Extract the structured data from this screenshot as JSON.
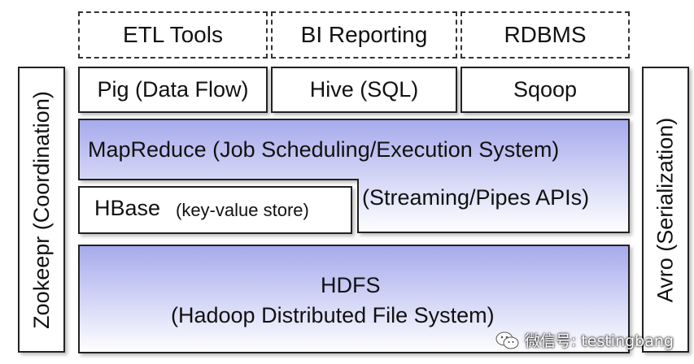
{
  "top_row": {
    "etl": "ETL Tools",
    "bi": "BI Reporting",
    "rdbms": "RDBMS"
  },
  "tools_row": {
    "pig": "Pig (Data Flow)",
    "hive": "Hive (SQL)",
    "sqoop": "Sqoop"
  },
  "mapreduce": {
    "title": "MapReduce (Job Scheduling/Execution System)",
    "streaming": "(Streaming/Pipes APIs)"
  },
  "hbase": {
    "name": "HBase",
    "note": "(key-value store)"
  },
  "hdfs": {
    "title": "HDFS",
    "subtitle": "(Hadoop Distributed File System)"
  },
  "side": {
    "left": "Zookeepr (Coordination)",
    "right": "Avro (Serialization)"
  },
  "watermark": {
    "text": "微信号: testingbang",
    "icon": "wechat-icon"
  },
  "colors": {
    "gradient_top": "#aaaeee",
    "gradient_bottom": "#ffffff",
    "border": "#222222"
  }
}
